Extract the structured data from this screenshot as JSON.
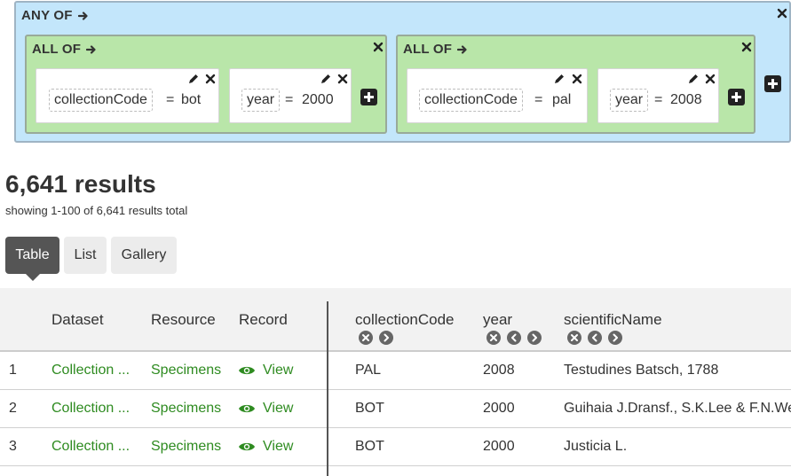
{
  "query": {
    "root_label": "ANY OF",
    "groups": [
      {
        "label": "ALL OF",
        "terms": [
          {
            "field": "collectionCode",
            "op": "=",
            "value": "bot"
          },
          {
            "field": "year",
            "op": "=",
            "value": "2000"
          }
        ]
      },
      {
        "label": "ALL OF",
        "terms": [
          {
            "field": "collectionCode",
            "op": "=",
            "value": "pal"
          },
          {
            "field": "year",
            "op": "=",
            "value": "2008"
          }
        ]
      }
    ]
  },
  "results": {
    "count_title": "6,641 results",
    "subtitle": "showing 1-100 of 6,641 results total"
  },
  "tabs": [
    {
      "label": "Table",
      "active": true
    },
    {
      "label": "List",
      "active": false
    },
    {
      "label": "Gallery",
      "active": false
    }
  ],
  "table": {
    "columns": [
      "Dataset",
      "Resource",
      "Record",
      "collectionCode",
      "year",
      "scientificName"
    ],
    "rows": [
      {
        "num": "1",
        "dataset": "Collection ...",
        "resource": "Specimens",
        "record": "View",
        "collectionCode": "PAL",
        "year": "2008",
        "scientificName": "Testudines Batsch, 1788"
      },
      {
        "num": "2",
        "dataset": "Collection ...",
        "resource": "Specimens",
        "record": "View",
        "collectionCode": "BOT",
        "year": "2000",
        "scientificName": "Guihaia J.Dransf., S.K.Lee & F.N.Wei"
      },
      {
        "num": "3",
        "dataset": "Collection ...",
        "resource": "Specimens",
        "record": "View",
        "collectionCode": "BOT",
        "year": "2000",
        "scientificName": "Justicia L."
      }
    ]
  },
  "icons": {
    "arrow": "arrow-right-icon",
    "close": "close-icon",
    "edit": "pencil-icon",
    "add": "plus-square-icon",
    "remove_column": "remove-circle-icon",
    "move_left": "chevron-left-circle-icon",
    "move_right": "chevron-right-circle-icon",
    "view": "eye-icon"
  },
  "colors": {
    "any_of_bg": "#c3e6fb",
    "all_of_bg": "#b9e6a9",
    "link": "#2e8b20",
    "active_tab": "#555555"
  }
}
